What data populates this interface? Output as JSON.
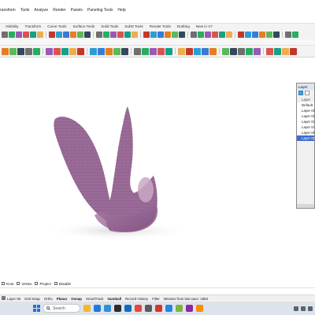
{
  "menu": [
    "ransform",
    "Tools",
    "Analyze",
    "Render",
    "Panels",
    "Paneling Tools",
    "Help"
  ],
  "toolbar_tabs": [
    "Visibility",
    "Transform",
    "Curve Tools",
    "Surface Tools",
    "Solid Tools",
    "SubD Tools",
    "Render Tools",
    "Drafting",
    "New in V7"
  ],
  "colors": {
    "model": "#9b6c98",
    "selection": "#3f6fd0",
    "taskbar": "#dde3ea"
  },
  "layers_panel": {
    "title": "Layer",
    "header": "Layer",
    "items": [
      {
        "name": "Default",
        "selected": false
      },
      {
        "name": "Layer 01",
        "selected": false
      },
      {
        "name": "Layer 02",
        "selected": false
      },
      {
        "name": "Layer 03",
        "selected": false
      },
      {
        "name": "Layer 04",
        "selected": false
      },
      {
        "name": "Layer 05",
        "selected": false
      },
      {
        "name": "Layer 06",
        "selected": true
      }
    ]
  },
  "osnaps": [
    {
      "label": "Knot",
      "checked": false
    },
    {
      "label": "Vertex",
      "checked": false
    },
    {
      "label": "Project",
      "checked": false
    },
    {
      "label": "Disable",
      "checked": false
    }
  ],
  "statusbar": {
    "layer": "Layer 06",
    "items": [
      {
        "label": "Grid Snap",
        "on": false
      },
      {
        "label": "Ortho",
        "on": false
      },
      {
        "label": "Planar",
        "on": true
      },
      {
        "label": "Osnap",
        "on": true
      },
      {
        "label": "SmartTrack",
        "on": false
      },
      {
        "label": "Gumball",
        "on": true
      },
      {
        "label": "Record History",
        "on": false
      },
      {
        "label": "Filter",
        "on": false
      },
      {
        "label": "Minutes from last save: 1883",
        "on": false
      }
    ]
  },
  "taskbar": {
    "search_placeholder": "Search",
    "apps": [
      "file-explorer-icon",
      "edge-icon",
      "store-icon",
      "rhino-icon",
      "mail-icon",
      "chrome-icon",
      "settings-icon",
      "app-icon",
      "app-icon-2",
      "app-icon-3",
      "app-icon-4",
      "app-icon-5"
    ]
  }
}
